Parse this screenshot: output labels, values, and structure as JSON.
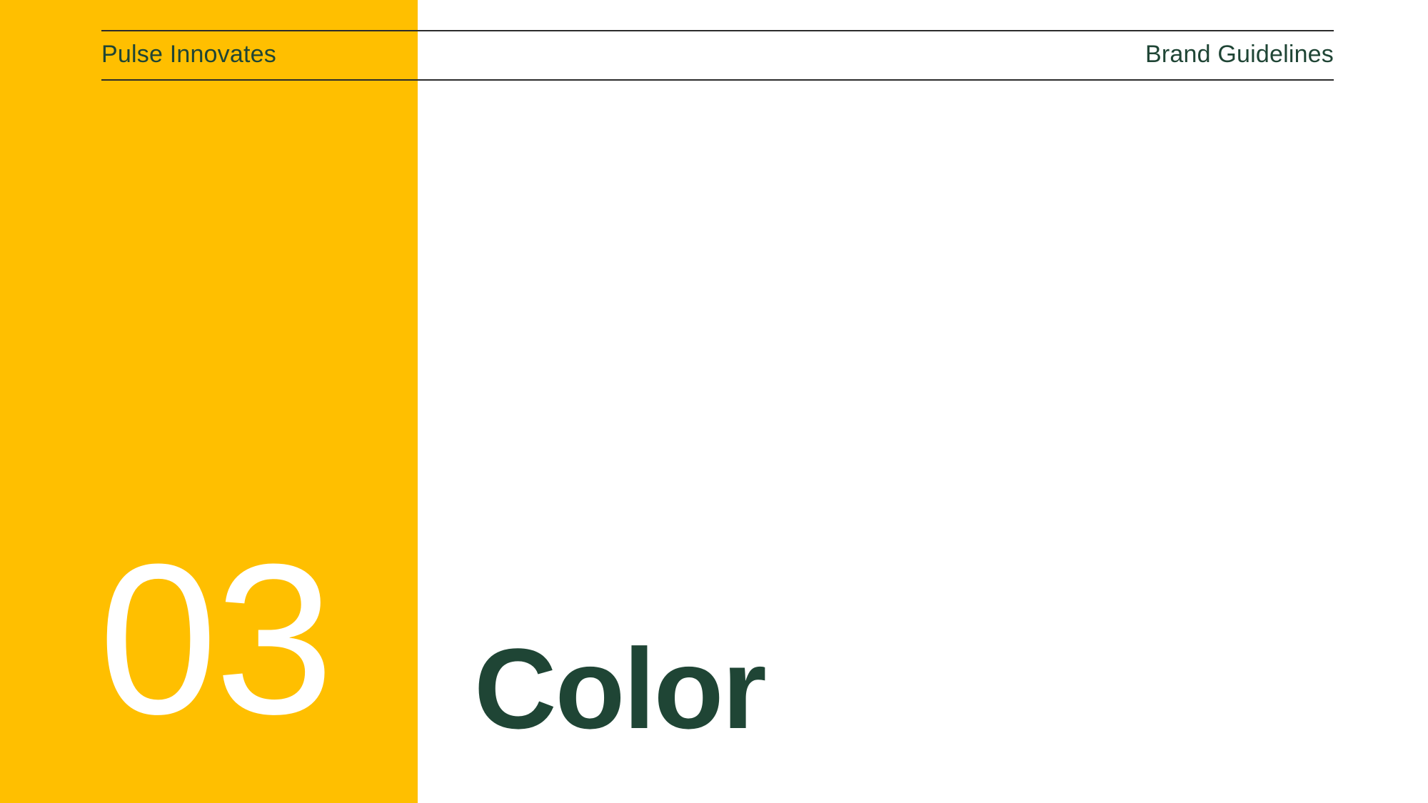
{
  "header": {
    "company": "Pulse Innovates",
    "document_title": "Brand Guidelines"
  },
  "section": {
    "number": "03",
    "title": "Color"
  },
  "colors": {
    "accent_yellow": "#FFBF00",
    "dark_green": "#1F4535",
    "background": "#FFFFFF",
    "rule_line": "#2B2B2B"
  }
}
